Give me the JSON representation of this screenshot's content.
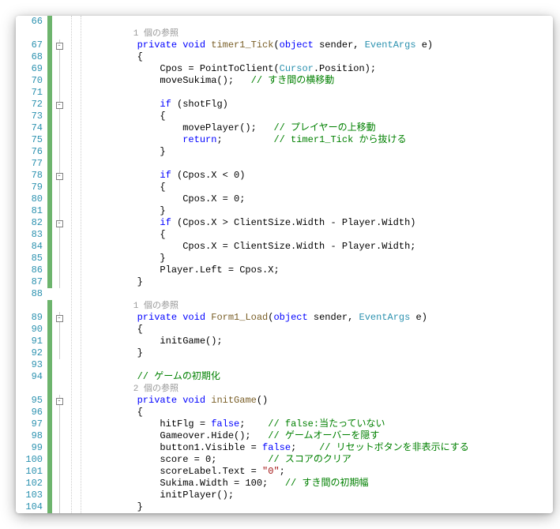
{
  "lines": [
    {
      "n": 66,
      "change": "green",
      "outline": "",
      "tokens": []
    },
    {
      "n": null,
      "change": "green",
      "outline": "",
      "tokens": [
        {
          "cls": "ref",
          "indent": 8,
          "t": "1 個の参照"
        }
      ]
    },
    {
      "n": 67,
      "change": "green",
      "outline": "box",
      "tokens": [
        {
          "cls": "kw",
          "indent": 8,
          "t": "private"
        },
        {
          "cls": "txt",
          "t": " "
        },
        {
          "cls": "kw",
          "t": "void"
        },
        {
          "cls": "txt",
          "t": " "
        },
        {
          "cls": "method",
          "t": "timer1_Tick"
        },
        {
          "cls": "txt",
          "t": "("
        },
        {
          "cls": "kw",
          "t": "object"
        },
        {
          "cls": "txt",
          "t": " sender, "
        },
        {
          "cls": "type",
          "t": "EventArgs"
        },
        {
          "cls": "txt",
          "t": " e)"
        }
      ]
    },
    {
      "n": 68,
      "change": "green",
      "outline": "line",
      "tokens": [
        {
          "cls": "txt",
          "indent": 8,
          "t": "{"
        }
      ]
    },
    {
      "n": 69,
      "change": "green",
      "outline": "line",
      "tokens": [
        {
          "cls": "txt",
          "indent": 12,
          "t": "Cpos = PointToClient("
        },
        {
          "cls": "type",
          "t": "Cursor"
        },
        {
          "cls": "txt",
          "t": ".Position);"
        }
      ]
    },
    {
      "n": 70,
      "change": "green",
      "outline": "line",
      "tokens": [
        {
          "cls": "txt",
          "indent": 12,
          "t": "moveSukima();   "
        },
        {
          "cls": "cmt",
          "t": "// すき間の横移動"
        }
      ]
    },
    {
      "n": 71,
      "change": "green",
      "outline": "line",
      "tokens": []
    },
    {
      "n": 72,
      "change": "green",
      "outline": "box",
      "tokens": [
        {
          "cls": "kw",
          "indent": 12,
          "t": "if"
        },
        {
          "cls": "txt",
          "t": " (shotFlg)"
        }
      ]
    },
    {
      "n": 73,
      "change": "green",
      "outline": "line",
      "tokens": [
        {
          "cls": "txt",
          "indent": 12,
          "t": "{"
        }
      ]
    },
    {
      "n": 74,
      "change": "green",
      "outline": "line",
      "tokens": [
        {
          "cls": "txt",
          "indent": 16,
          "t": "movePlayer();   "
        },
        {
          "cls": "cmt",
          "t": "// プレイヤーの上移動"
        }
      ]
    },
    {
      "n": 75,
      "change": "green",
      "outline": "line",
      "tokens": [
        {
          "cls": "kw",
          "indent": 16,
          "t": "return"
        },
        {
          "cls": "txt",
          "t": ";         "
        },
        {
          "cls": "cmt",
          "t": "// timer1_Tick から抜ける"
        }
      ]
    },
    {
      "n": 76,
      "change": "green",
      "outline": "line",
      "tokens": [
        {
          "cls": "txt",
          "indent": 12,
          "t": "}"
        }
      ]
    },
    {
      "n": 77,
      "change": "green",
      "outline": "line",
      "tokens": []
    },
    {
      "n": 78,
      "change": "green",
      "outline": "box",
      "tokens": [
        {
          "cls": "kw",
          "indent": 12,
          "t": "if"
        },
        {
          "cls": "txt",
          "t": " (Cpos.X < 0)"
        }
      ]
    },
    {
      "n": 79,
      "change": "green",
      "outline": "line",
      "tokens": [
        {
          "cls": "txt",
          "indent": 12,
          "t": "{"
        }
      ]
    },
    {
      "n": 80,
      "change": "green",
      "outline": "line",
      "tokens": [
        {
          "cls": "txt",
          "indent": 16,
          "t": "Cpos.X = 0;"
        }
      ]
    },
    {
      "n": 81,
      "change": "green",
      "outline": "line",
      "tokens": [
        {
          "cls": "txt",
          "indent": 12,
          "t": "}"
        }
      ]
    },
    {
      "n": 82,
      "change": "green",
      "outline": "box",
      "tokens": [
        {
          "cls": "kw",
          "indent": 12,
          "t": "if"
        },
        {
          "cls": "txt",
          "t": " (Cpos.X > ClientSize.Width - Player.Width)"
        }
      ]
    },
    {
      "n": 83,
      "change": "green",
      "outline": "line",
      "tokens": [
        {
          "cls": "txt",
          "indent": 12,
          "t": "{"
        }
      ]
    },
    {
      "n": 84,
      "change": "green",
      "outline": "line",
      "tokens": [
        {
          "cls": "txt",
          "indent": 16,
          "t": "Cpos.X = ClientSize.Width - Player.Width;"
        }
      ]
    },
    {
      "n": 85,
      "change": "green",
      "outline": "line",
      "tokens": [
        {
          "cls": "txt",
          "indent": 12,
          "t": "}"
        }
      ]
    },
    {
      "n": 86,
      "change": "green",
      "outline": "line",
      "tokens": [
        {
          "cls": "txt",
          "indent": 12,
          "t": "Player.Left = Cpos.X;"
        }
      ]
    },
    {
      "n": 87,
      "change": "green",
      "outline": "line",
      "tokens": [
        {
          "cls": "txt",
          "indent": 8,
          "t": "}"
        }
      ]
    },
    {
      "n": 88,
      "change": "",
      "outline": "",
      "tokens": []
    },
    {
      "n": null,
      "change": "green",
      "outline": "",
      "tokens": [
        {
          "cls": "ref",
          "indent": 8,
          "t": "1 個の参照"
        }
      ]
    },
    {
      "n": 89,
      "change": "green",
      "outline": "box",
      "tokens": [
        {
          "cls": "kw",
          "indent": 8,
          "t": "private"
        },
        {
          "cls": "txt",
          "t": " "
        },
        {
          "cls": "kw",
          "t": "void"
        },
        {
          "cls": "txt",
          "t": " "
        },
        {
          "cls": "method",
          "t": "Form1_Load"
        },
        {
          "cls": "txt",
          "t": "("
        },
        {
          "cls": "kw",
          "t": "object"
        },
        {
          "cls": "txt",
          "t": " sender, "
        },
        {
          "cls": "type",
          "t": "EventArgs"
        },
        {
          "cls": "txt",
          "t": " e)"
        }
      ]
    },
    {
      "n": 90,
      "change": "green",
      "outline": "line",
      "tokens": [
        {
          "cls": "txt",
          "indent": 8,
          "t": "{"
        }
      ]
    },
    {
      "n": 91,
      "change": "green",
      "outline": "line",
      "tokens": [
        {
          "cls": "txt",
          "indent": 12,
          "t": "initGame();"
        }
      ]
    },
    {
      "n": 92,
      "change": "green",
      "outline": "line",
      "tokens": [
        {
          "cls": "txt",
          "indent": 8,
          "t": "}"
        }
      ]
    },
    {
      "n": 93,
      "change": "green",
      "outline": "",
      "tokens": []
    },
    {
      "n": 94,
      "change": "green",
      "outline": "",
      "tokens": [
        {
          "cls": "cmt",
          "indent": 8,
          "t": "// ゲームの初期化"
        }
      ]
    },
    {
      "n": null,
      "change": "green",
      "outline": "",
      "tokens": [
        {
          "cls": "ref",
          "indent": 8,
          "t": "2 個の参照"
        }
      ]
    },
    {
      "n": 95,
      "change": "green",
      "outline": "box",
      "tokens": [
        {
          "cls": "kw",
          "indent": 8,
          "t": "private"
        },
        {
          "cls": "txt",
          "t": " "
        },
        {
          "cls": "kw",
          "t": "void"
        },
        {
          "cls": "txt",
          "t": " "
        },
        {
          "cls": "method",
          "t": "initGame"
        },
        {
          "cls": "txt",
          "t": "()"
        }
      ]
    },
    {
      "n": 96,
      "change": "green",
      "outline": "line",
      "tokens": [
        {
          "cls": "txt",
          "indent": 8,
          "t": "{"
        }
      ]
    },
    {
      "n": 97,
      "change": "green",
      "outline": "line",
      "tokens": [
        {
          "cls": "txt",
          "indent": 12,
          "t": "hitFlg = "
        },
        {
          "cls": "kw",
          "t": "false"
        },
        {
          "cls": "txt",
          "t": ";    "
        },
        {
          "cls": "cmt",
          "t": "// false:当たっていない"
        }
      ]
    },
    {
      "n": 98,
      "change": "green",
      "outline": "line",
      "tokens": [
        {
          "cls": "txt",
          "indent": 12,
          "t": "Gameover.Hide();   "
        },
        {
          "cls": "cmt",
          "t": "// ゲームオーバーを隠す"
        }
      ]
    },
    {
      "n": 99,
      "change": "green",
      "outline": "line",
      "tokens": [
        {
          "cls": "txt",
          "indent": 12,
          "t": "button1.Visible = "
        },
        {
          "cls": "kw",
          "t": "false"
        },
        {
          "cls": "txt",
          "t": ";    "
        },
        {
          "cls": "cmt",
          "t": "// リセットボタンを非表示にする"
        }
      ]
    },
    {
      "n": 100,
      "change": "green",
      "outline": "line",
      "tokens": [
        {
          "cls": "txt",
          "indent": 12,
          "t": "score = 0;         "
        },
        {
          "cls": "cmt",
          "t": "// スコアのクリア"
        }
      ]
    },
    {
      "n": 101,
      "change": "green",
      "outline": "line",
      "tokens": [
        {
          "cls": "txt",
          "indent": 12,
          "t": "scoreLabel.Text = "
        },
        {
          "cls": "str",
          "t": "\"0\""
        },
        {
          "cls": "txt",
          "t": ";"
        }
      ]
    },
    {
      "n": 102,
      "change": "green",
      "outline": "line",
      "tokens": [
        {
          "cls": "txt",
          "indent": 12,
          "t": "Sukima.Width = 100;   "
        },
        {
          "cls": "cmt",
          "t": "// すき間の初期幅"
        }
      ]
    },
    {
      "n": 103,
      "change": "green",
      "outline": "line",
      "tokens": [
        {
          "cls": "txt",
          "indent": 12,
          "t": "initPlayer();"
        }
      ]
    },
    {
      "n": 104,
      "change": "green",
      "outline": "line",
      "tokens": [
        {
          "cls": "txt",
          "indent": 8,
          "t": "}"
        }
      ]
    }
  ]
}
